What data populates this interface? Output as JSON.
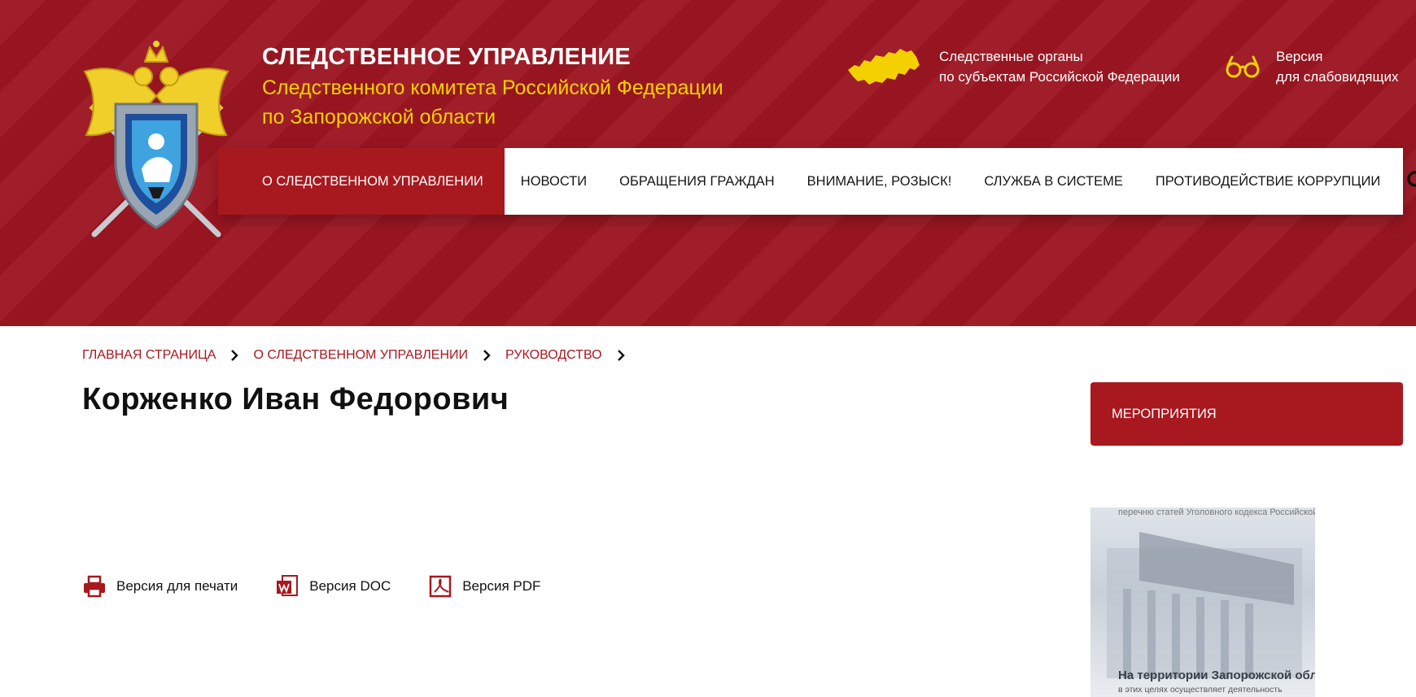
{
  "header": {
    "title_main": "СЛЕДСТВЕННОЕ УПРАВЛЕНИЕ",
    "title_sub_line1": "Следственного комитета Российской Федерации",
    "title_sub_line2": "по Запорожской области",
    "regions_line1": "Следственные органы",
    "regions_line2": "по субъектам Российской Федерации",
    "vision_line1": "Версия",
    "vision_line2": "для слабовидящих",
    "accent_color": "#9c1621",
    "title_color": "#f5d000",
    "icons": [
      "emblem-icon",
      "russia-map-icon",
      "glasses-icon",
      "search-icon"
    ]
  },
  "nav": {
    "items": [
      {
        "label": "О следственном управлении",
        "active": true
      },
      {
        "label": "Новости",
        "active": false
      },
      {
        "label": "Обращения граждан",
        "active": false
      },
      {
        "label": "Внимание, розыск!",
        "active": false
      },
      {
        "label": "Служба в системе",
        "active": false
      },
      {
        "label": "Противодействие коррупции",
        "active": false
      }
    ]
  },
  "breadcrumb": {
    "items": [
      "Главная страница",
      "О следственном управлении",
      "Руководство"
    ]
  },
  "page": {
    "title": "Корженко Иван Федорович"
  },
  "downloads": {
    "print_label": "Версия для печати",
    "doc_label": "Версия DOC",
    "pdf_label": "Версия PDF",
    "icons": [
      "printer-icon",
      "doc-icon",
      "pdf-icon"
    ]
  },
  "sidebar": {
    "events_label": "Мероприятия",
    "banner": {
      "top_text": "перечню статей Уголовного кодекса Российской",
      "caption": "На территории Запорожской области",
      "small_text": "в этих целях осуществляет деятельность"
    }
  }
}
